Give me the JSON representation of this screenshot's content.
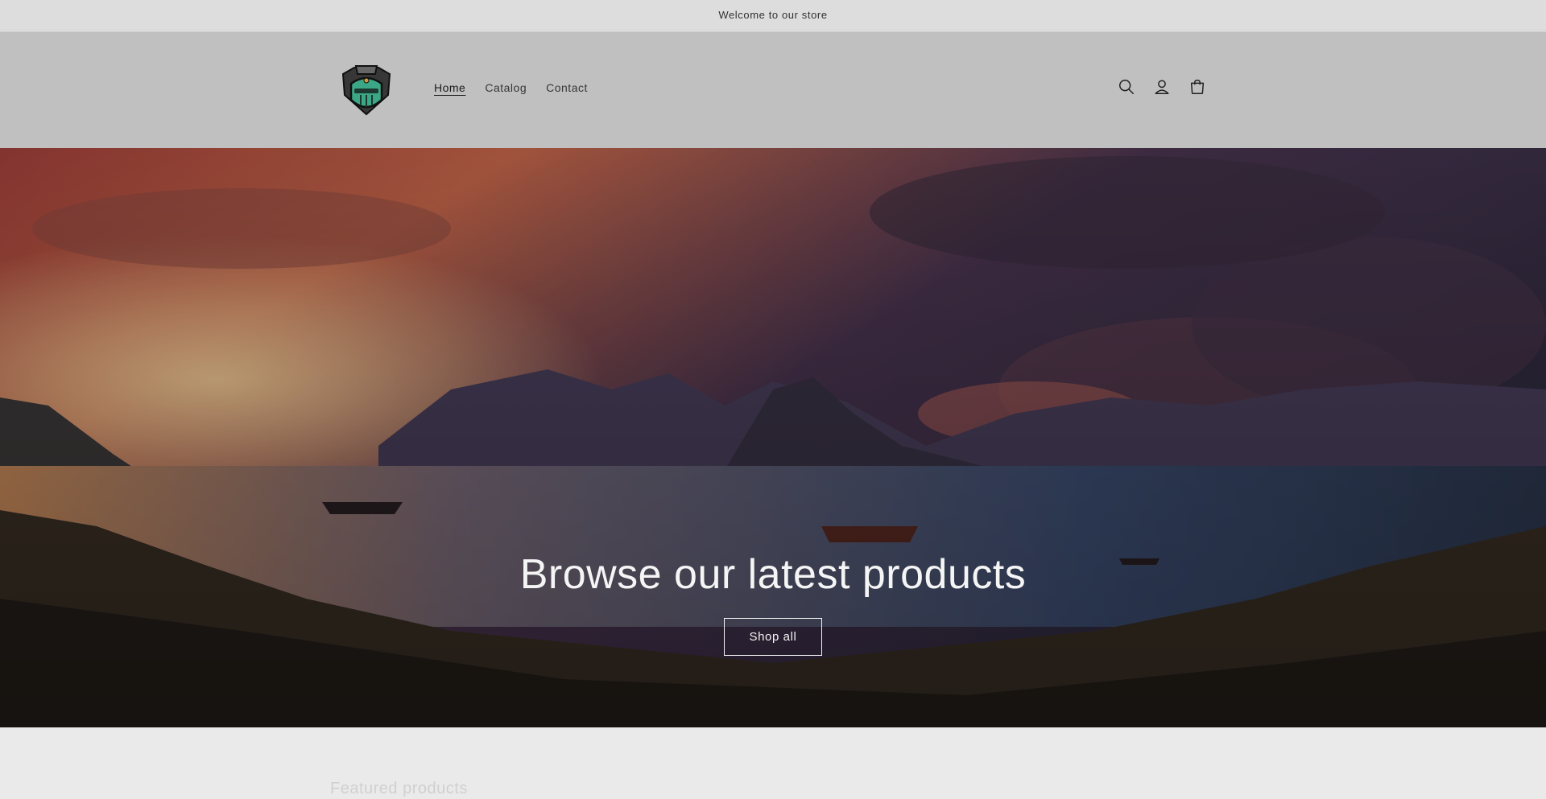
{
  "announcement": {
    "text": "Welcome to our store"
  },
  "header": {
    "logo_icon": "knight-helmet-logo",
    "nav": [
      {
        "label": "Home",
        "active": true
      },
      {
        "label": "Catalog",
        "active": false
      },
      {
        "label": "Contact",
        "active": false
      }
    ],
    "icons": [
      "search-icon",
      "account-icon",
      "cart-icon"
    ]
  },
  "hero": {
    "title": "Browse our latest products",
    "button_label": "Shop all"
  },
  "below": {
    "heading": "Featured products"
  },
  "colors": {
    "announcement_bg": "#e6e6e6",
    "header_bg": "#c8c8c8",
    "logo_green": "#3fae8c",
    "hero_text": "#ffffff"
  }
}
